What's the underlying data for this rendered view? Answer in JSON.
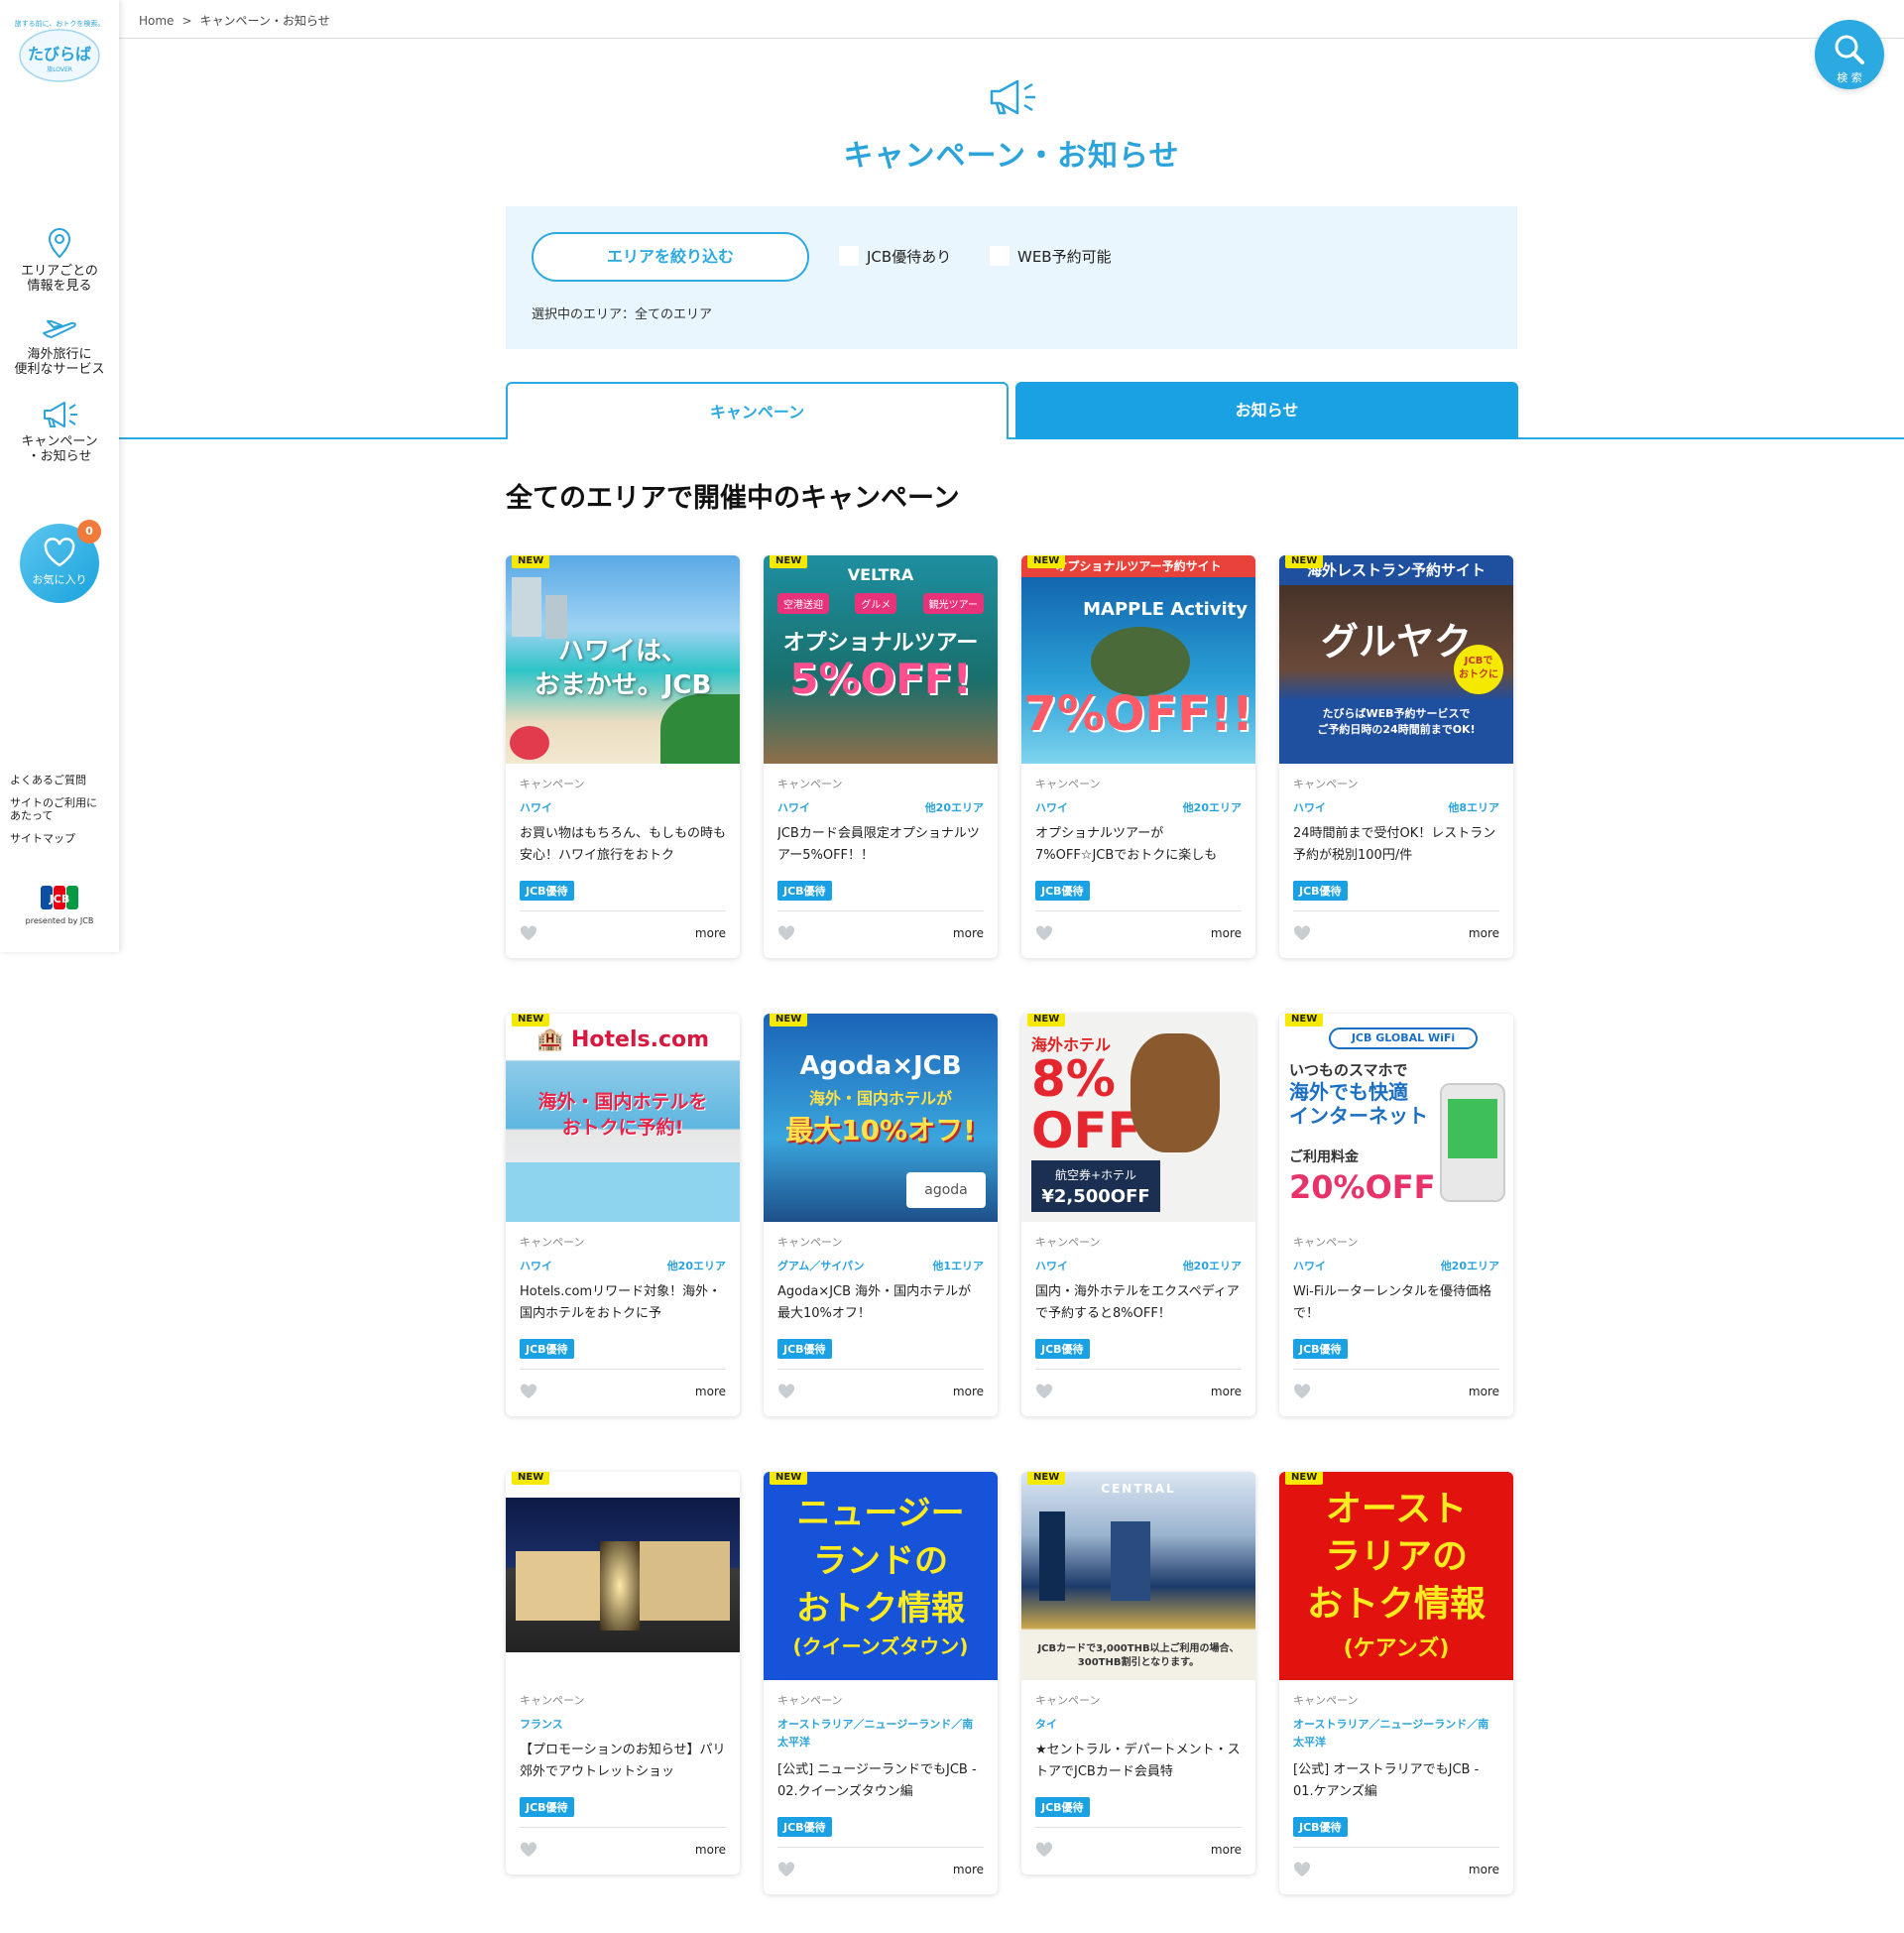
{
  "logo": {
    "tagline": "旅する前に、おトクを検索。",
    "name": "たびらば",
    "sub": "旅LOVER"
  },
  "breadcrumb": {
    "home": "Home",
    "sep": ">",
    "current": "キャンペーン・お知らせ"
  },
  "search": {
    "label": "検 索"
  },
  "sidebar": {
    "items": [
      {
        "label": "エリアごとの\n情報を見る",
        "icon": "map-pin-icon"
      },
      {
        "label": "海外旅行に\n便利なサービス",
        "icon": "airplane-icon"
      },
      {
        "label": "キャンペーン\n・お知らせ",
        "icon": "megaphone-icon"
      }
    ],
    "favorites": {
      "label": "お気に入り",
      "count": "0"
    },
    "links": [
      "よくあるご質問",
      "サイトのご利用に\nあたって",
      "サイトマップ"
    ],
    "jcb": {
      "mark": "JCB",
      "presented": "presented by JCB"
    }
  },
  "page": {
    "title": "キャンペーン・お知らせ",
    "section_title": "全てのエリアで開催中のキャンペーン"
  },
  "filter": {
    "area_button": "エリアを絞り込む",
    "check_jcb": "JCB優待あり",
    "check_web": "WEB予約可能",
    "selected_area": "選択中のエリア：全てのエリア"
  },
  "tabs": {
    "campaign": "キャンペーン",
    "news": "お知らせ"
  },
  "colors": {
    "accent": "#2ba9e1",
    "tab_active_bg": "#19a1e3",
    "filter_bg": "#eaf6fd",
    "new_badge": "#f6e900"
  },
  "card_common": {
    "new": "NEW",
    "jcb_tag": "JCB優待",
    "more": "more"
  },
  "cards": [
    {
      "category": "キャンペーン",
      "area": "ハワイ",
      "other": "",
      "text": "お買い物はもちろん、もしもの時も安心！ハワイ旅行をおトク",
      "thumb": "ハワイは、おまかせ。JCB"
    },
    {
      "category": "キャンペーン",
      "area": "ハワイ",
      "other": "他20エリア",
      "text": "JCBカード会員限定オプショナルツアー5%OFF！！",
      "thumb": "VELTRA オプショナルツアー 5%OFF!"
    },
    {
      "category": "キャンペーン",
      "area": "ハワイ",
      "other": "他20エリア",
      "text": "オプショナルツアーが7%OFF☆JCBでおトクに楽しも",
      "thumb": "MAPPLE Activity 7%OFF!!"
    },
    {
      "category": "キャンペーン",
      "area": "ハワイ",
      "other": "他8エリア",
      "text": "24時間前まで受付OK！レストラン予約が税別100円/件",
      "thumb": "海外レストラン予約サイト グルヤク"
    },
    {
      "category": "キャンペーン",
      "area": "ハワイ",
      "other": "他20エリア",
      "text": "Hotels.comリワード対象！海外・国内ホテルをおトクに予",
      "thumb": "Hotels.com 海外・国内ホテルをおトクに予約!"
    },
    {
      "category": "キャンペーン",
      "area": "グアム／サイパン",
      "other": "他1エリア",
      "text": "Agoda×JCB 海外・国内ホテルが最大10%オフ！",
      "thumb": "Agoda×JCB 最大10%オフ!"
    },
    {
      "category": "キャンペーン",
      "area": "ハワイ",
      "other": "他20エリア",
      "text": "国内・海外ホテルをエクスペディアで予約すると8%OFF！",
      "thumb": "海外ホテル 8%OFF"
    },
    {
      "category": "キャンペーン",
      "area": "ハワイ",
      "other": "他20エリア",
      "text": "Wi-Fiルーターレンタルを優待価格で！",
      "thumb": "JCB GLOBAL WiFi 20%OFF"
    },
    {
      "category": "キャンペーン",
      "area": "フランス",
      "other": "",
      "text": "【プロモーションのお知らせ】パリ郊外でアウトレットショッ",
      "thumb": ""
    },
    {
      "category": "キャンペーン",
      "area": "オーストラリア／ニュージーランド／南太平洋",
      "other": "",
      "text": "[公式] ニュージーランドでもJCB - 02.クイーンズタウン編",
      "thumb": "ニュージーランドのおトク情報(クイーンズタウン)"
    },
    {
      "category": "キャンペーン",
      "area": "タイ",
      "other": "",
      "text": "★セントラル・デパートメント・ストアでJCBカード会員特",
      "thumb": "CENTRAL"
    },
    {
      "category": "キャンペーン",
      "area": "オーストラリア／ニュージーランド／南太平洋",
      "other": "",
      "text": "[公式] オーストラリアでもJCB - 01.ケアンズ編",
      "thumb": "オーストラリアのおトク情報(ケアンズ)"
    }
  ]
}
